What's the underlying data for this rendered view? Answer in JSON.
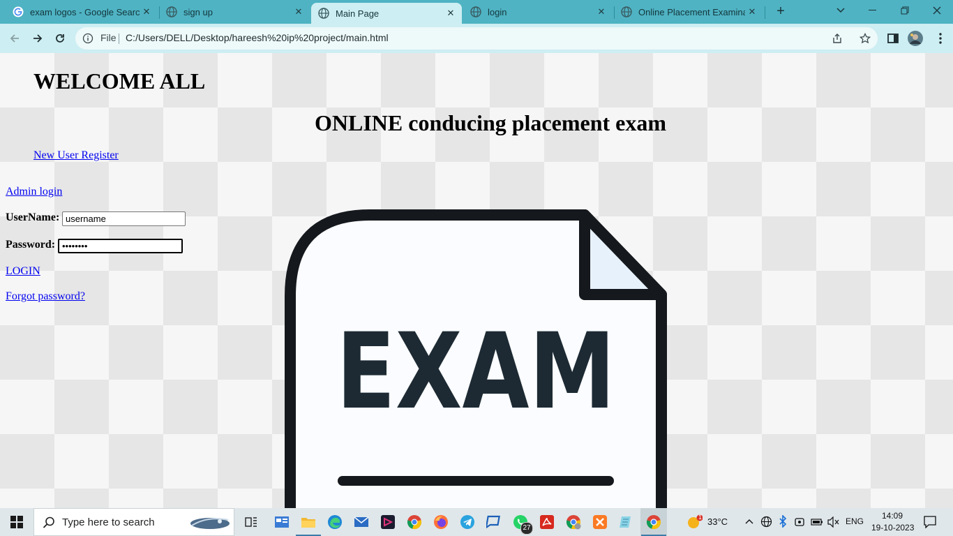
{
  "browser": {
    "tabs": [
      {
        "title": "exam logos - Google Search",
        "icon": "google-icon",
        "active": false
      },
      {
        "title": "sign up",
        "icon": "globe-icon",
        "active": false
      },
      {
        "title": "Main Page",
        "icon": "globe-icon",
        "active": true
      },
      {
        "title": "login",
        "icon": "globe-icon",
        "active": false
      },
      {
        "title": "Online Placement Examinatio",
        "icon": "globe-icon",
        "active": false
      }
    ],
    "address": {
      "scheme_label": "File",
      "url": "C:/Users/DELL/Desktop/hareesh%20ip%20project/main.html"
    }
  },
  "page": {
    "welcome_heading": "WELCOME ALL",
    "main_heading": "ONLINE conducing placement exam",
    "new_user_link": "New User Register",
    "admin_link": "Admin login",
    "username_label": "UserName:",
    "username_value": "username",
    "password_label": "Password:",
    "password_value": "••••••••",
    "login_link": "LOGIN",
    "forgot_link": "Forgot password?",
    "logo_text": "EXAM"
  },
  "taskbar": {
    "search_placeholder": "Type here to search",
    "whatsapp_badge": "27",
    "weather_badge": "1",
    "temperature": "33°C",
    "language": "ENG",
    "time": "14:09",
    "date": "19-10-2023"
  },
  "colors": {
    "tab_strip": "#4fb3c3",
    "toolbar": "#cdeef2",
    "link": "#0000ee",
    "taskbar": "#dfe7ea"
  }
}
